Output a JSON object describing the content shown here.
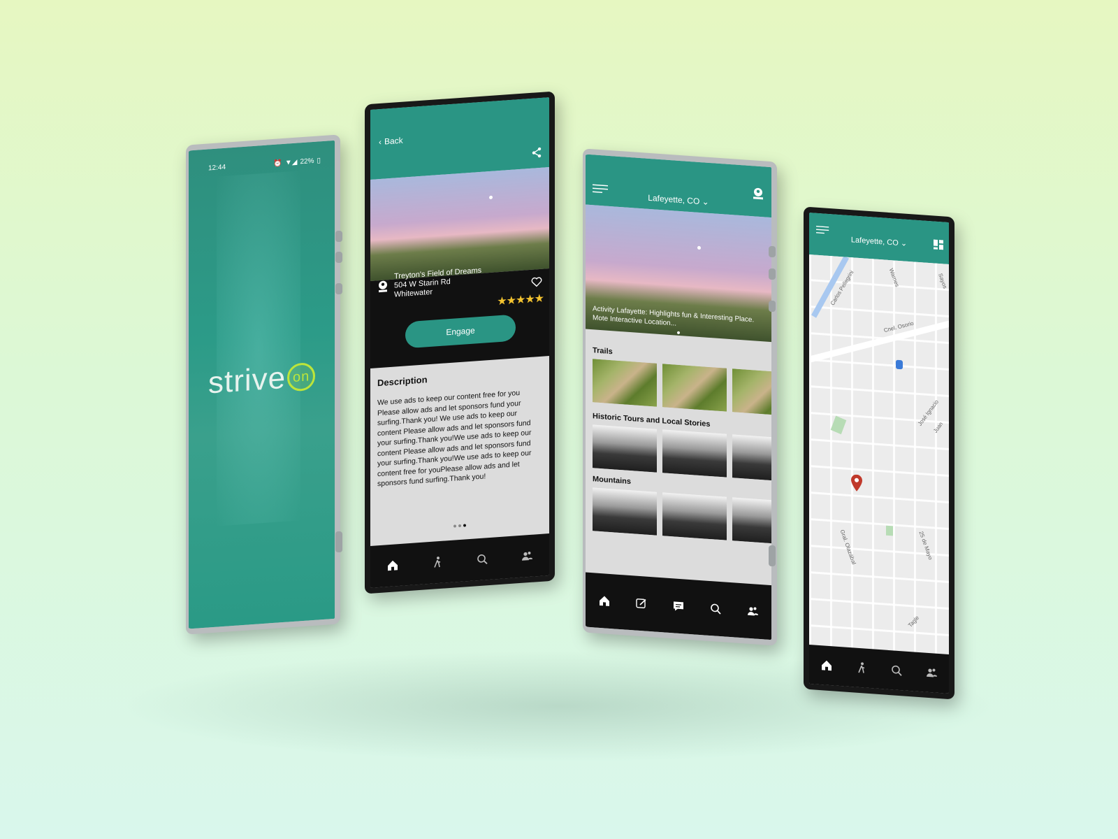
{
  "splash": {
    "status_time": "12:44",
    "status_battery": "22%",
    "logo_word": "strive",
    "logo_circle": "on"
  },
  "detail": {
    "back_label": "Back",
    "place_name": "Treyton's Field of Dreams",
    "place_street": "504 W Starin Rd",
    "place_city": "Whitewater",
    "rating_stars": "★★★★★",
    "engage_label": "Engage",
    "description_title": "Description",
    "description_text": "We use ads to keep our content free for you Please allow ads and let sponsors fund your surfing.Thank you! We use ads to keep our content Please allow ads and let sponsors fund your surfing.Thank you!We use ads to keep our content Please allow ads and let sponsors fund your surfing.Thank you!We use ads to keep our content free for youPlease allow ads and let sponsors fund surfing.Thank you!"
  },
  "home": {
    "location_label": "Lafeyette, CO",
    "hero_caption": "Activity Lafayette: Highlights fun & Interesting Place. Mote Interactive Location...",
    "sections": [
      {
        "title": "Trails"
      },
      {
        "title": "Historic Tours and Local Stories"
      },
      {
        "title": "Mountains"
      }
    ]
  },
  "map_screen": {
    "location_label": "Lafeyette, CO",
    "streets": [
      "Carlos Pellegrini",
      "Warnes",
      "Cnel. Osorio",
      "José Ignacio",
      "Juan",
      "Gral. Olazábal",
      "25 de Mayo",
      "Tagle",
      "Sayos"
    ]
  },
  "colors": {
    "brand_teal": "#2a9584",
    "accent_lime": "#bde53a",
    "star_gold": "#f4c430",
    "map_pin": "#c0392b"
  }
}
